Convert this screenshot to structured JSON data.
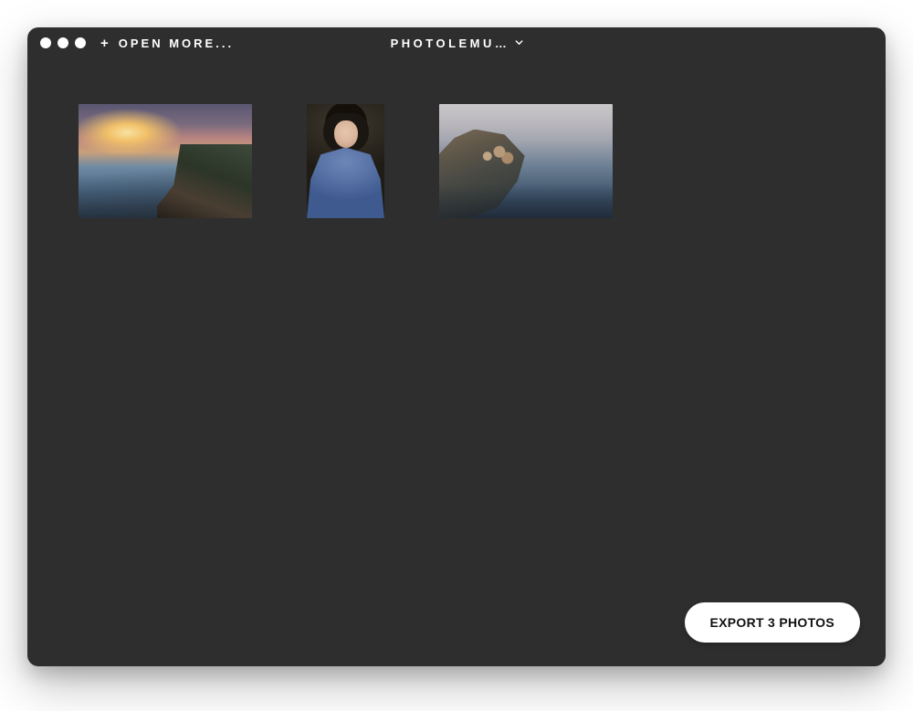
{
  "titlebar": {
    "open_more_label": "OPEN MORE...",
    "app_title": "PHOTOLEMU…"
  },
  "thumbnails": [
    {
      "name": "photo-thumbnail-1"
    },
    {
      "name": "photo-thumbnail-2"
    },
    {
      "name": "photo-thumbnail-3"
    }
  ],
  "export_button_label": "EXPORT 3 PHOTOS"
}
